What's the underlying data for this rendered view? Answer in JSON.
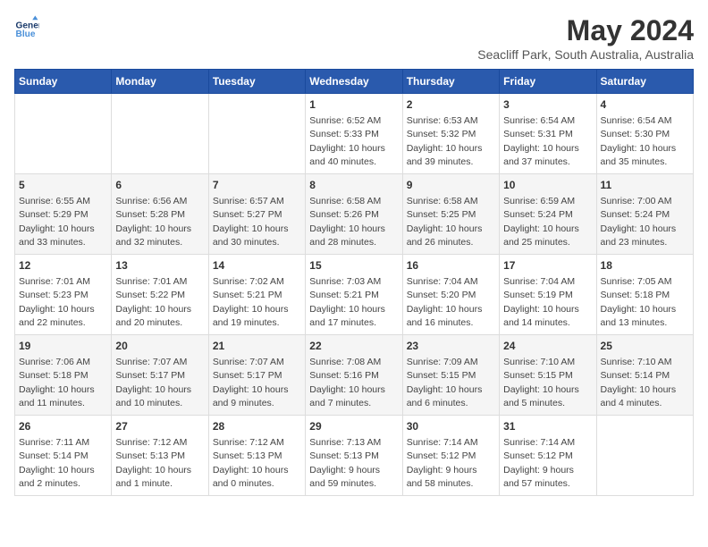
{
  "logo": {
    "line1": "General",
    "line2": "Blue"
  },
  "title": "May 2024",
  "subtitle": "Seacliff Park, South Australia, Australia",
  "days_of_week": [
    "Sunday",
    "Monday",
    "Tuesday",
    "Wednesday",
    "Thursday",
    "Friday",
    "Saturday"
  ],
  "weeks": [
    [
      {
        "day": "",
        "info": ""
      },
      {
        "day": "",
        "info": ""
      },
      {
        "day": "",
        "info": ""
      },
      {
        "day": "1",
        "info": "Sunrise: 6:52 AM\nSunset: 5:33 PM\nDaylight: 10 hours\nand 40 minutes."
      },
      {
        "day": "2",
        "info": "Sunrise: 6:53 AM\nSunset: 5:32 PM\nDaylight: 10 hours\nand 39 minutes."
      },
      {
        "day": "3",
        "info": "Sunrise: 6:54 AM\nSunset: 5:31 PM\nDaylight: 10 hours\nand 37 minutes."
      },
      {
        "day": "4",
        "info": "Sunrise: 6:54 AM\nSunset: 5:30 PM\nDaylight: 10 hours\nand 35 minutes."
      }
    ],
    [
      {
        "day": "5",
        "info": "Sunrise: 6:55 AM\nSunset: 5:29 PM\nDaylight: 10 hours\nand 33 minutes."
      },
      {
        "day": "6",
        "info": "Sunrise: 6:56 AM\nSunset: 5:28 PM\nDaylight: 10 hours\nand 32 minutes."
      },
      {
        "day": "7",
        "info": "Sunrise: 6:57 AM\nSunset: 5:27 PM\nDaylight: 10 hours\nand 30 minutes."
      },
      {
        "day": "8",
        "info": "Sunrise: 6:58 AM\nSunset: 5:26 PM\nDaylight: 10 hours\nand 28 minutes."
      },
      {
        "day": "9",
        "info": "Sunrise: 6:58 AM\nSunset: 5:25 PM\nDaylight: 10 hours\nand 26 minutes."
      },
      {
        "day": "10",
        "info": "Sunrise: 6:59 AM\nSunset: 5:24 PM\nDaylight: 10 hours\nand 25 minutes."
      },
      {
        "day": "11",
        "info": "Sunrise: 7:00 AM\nSunset: 5:24 PM\nDaylight: 10 hours\nand 23 minutes."
      }
    ],
    [
      {
        "day": "12",
        "info": "Sunrise: 7:01 AM\nSunset: 5:23 PM\nDaylight: 10 hours\nand 22 minutes."
      },
      {
        "day": "13",
        "info": "Sunrise: 7:01 AM\nSunset: 5:22 PM\nDaylight: 10 hours\nand 20 minutes."
      },
      {
        "day": "14",
        "info": "Sunrise: 7:02 AM\nSunset: 5:21 PM\nDaylight: 10 hours\nand 19 minutes."
      },
      {
        "day": "15",
        "info": "Sunrise: 7:03 AM\nSunset: 5:21 PM\nDaylight: 10 hours\nand 17 minutes."
      },
      {
        "day": "16",
        "info": "Sunrise: 7:04 AM\nSunset: 5:20 PM\nDaylight: 10 hours\nand 16 minutes."
      },
      {
        "day": "17",
        "info": "Sunrise: 7:04 AM\nSunset: 5:19 PM\nDaylight: 10 hours\nand 14 minutes."
      },
      {
        "day": "18",
        "info": "Sunrise: 7:05 AM\nSunset: 5:18 PM\nDaylight: 10 hours\nand 13 minutes."
      }
    ],
    [
      {
        "day": "19",
        "info": "Sunrise: 7:06 AM\nSunset: 5:18 PM\nDaylight: 10 hours\nand 11 minutes."
      },
      {
        "day": "20",
        "info": "Sunrise: 7:07 AM\nSunset: 5:17 PM\nDaylight: 10 hours\nand 10 minutes."
      },
      {
        "day": "21",
        "info": "Sunrise: 7:07 AM\nSunset: 5:17 PM\nDaylight: 10 hours\nand 9 minutes."
      },
      {
        "day": "22",
        "info": "Sunrise: 7:08 AM\nSunset: 5:16 PM\nDaylight: 10 hours\nand 7 minutes."
      },
      {
        "day": "23",
        "info": "Sunrise: 7:09 AM\nSunset: 5:15 PM\nDaylight: 10 hours\nand 6 minutes."
      },
      {
        "day": "24",
        "info": "Sunrise: 7:10 AM\nSunset: 5:15 PM\nDaylight: 10 hours\nand 5 minutes."
      },
      {
        "day": "25",
        "info": "Sunrise: 7:10 AM\nSunset: 5:14 PM\nDaylight: 10 hours\nand 4 minutes."
      }
    ],
    [
      {
        "day": "26",
        "info": "Sunrise: 7:11 AM\nSunset: 5:14 PM\nDaylight: 10 hours\nand 2 minutes."
      },
      {
        "day": "27",
        "info": "Sunrise: 7:12 AM\nSunset: 5:13 PM\nDaylight: 10 hours\nand 1 minute."
      },
      {
        "day": "28",
        "info": "Sunrise: 7:12 AM\nSunset: 5:13 PM\nDaylight: 10 hours\nand 0 minutes."
      },
      {
        "day": "29",
        "info": "Sunrise: 7:13 AM\nSunset: 5:13 PM\nDaylight: 9 hours\nand 59 minutes."
      },
      {
        "day": "30",
        "info": "Sunrise: 7:14 AM\nSunset: 5:12 PM\nDaylight: 9 hours\nand 58 minutes."
      },
      {
        "day": "31",
        "info": "Sunrise: 7:14 AM\nSunset: 5:12 PM\nDaylight: 9 hours\nand 57 minutes."
      },
      {
        "day": "",
        "info": ""
      }
    ]
  ]
}
